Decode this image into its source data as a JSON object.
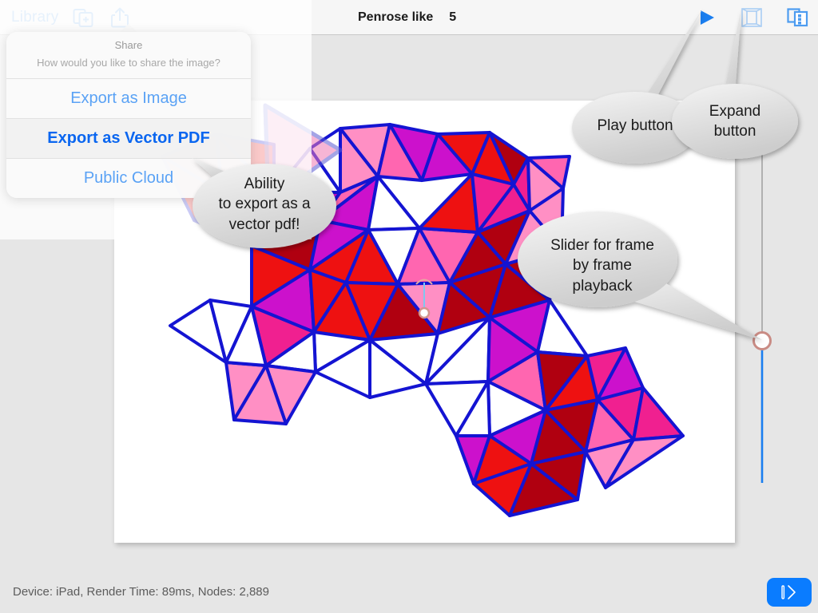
{
  "toolbar": {
    "library_label": "Library",
    "duplicate_icon": "duplicate-document-icon",
    "share_icon": "share-upload-icon",
    "document_title": "Penrose like",
    "frame_number": "5",
    "play_icon": "play-triangle-icon",
    "expand_icon": "expand-frame-icon",
    "panels_icon": "panels-list-icon"
  },
  "popover": {
    "title": "Share",
    "subtitle": "How would you like to share the image?",
    "options": [
      {
        "label": "Export as Image",
        "highlight": false
      },
      {
        "label": "Export as Vector PDF",
        "highlight": true
      },
      {
        "label": "Public Cloud",
        "highlight": false
      }
    ]
  },
  "callouts": [
    {
      "name": "export-callout",
      "lines": [
        "Ability",
        "to export as a",
        "vector pdf!"
      ]
    },
    {
      "name": "play-callout",
      "lines": [
        "Play button"
      ]
    },
    {
      "name": "expand-callout",
      "lines": [
        "Expand",
        "button"
      ]
    },
    {
      "name": "slider-callout",
      "lines": [
        "Slider for frame",
        "by frame",
        "playback"
      ]
    }
  ],
  "slider": {
    "name": "frame-slider",
    "thumb_color": "#c98b84",
    "filled_color": "#1a7ef0",
    "track_color": "#9a9a9a"
  },
  "status": {
    "text": "Device: iPad,   Render Time: 89ms,   Nodes: 2,889"
  },
  "fab": {
    "glyph": "| ⟩",
    "color": "#0a7cff"
  },
  "artwork": {
    "title": "Penrose like tiling",
    "stroke": "#1414d2",
    "palette": {
      "red": "#ee1111",
      "dark_red": "#b00010",
      "magenta": "#cc11cc",
      "pink": "#ff66b0",
      "light_pink": "#ff8fc4",
      "hot_pink": "#f02090",
      "white": "#ffffff"
    }
  }
}
